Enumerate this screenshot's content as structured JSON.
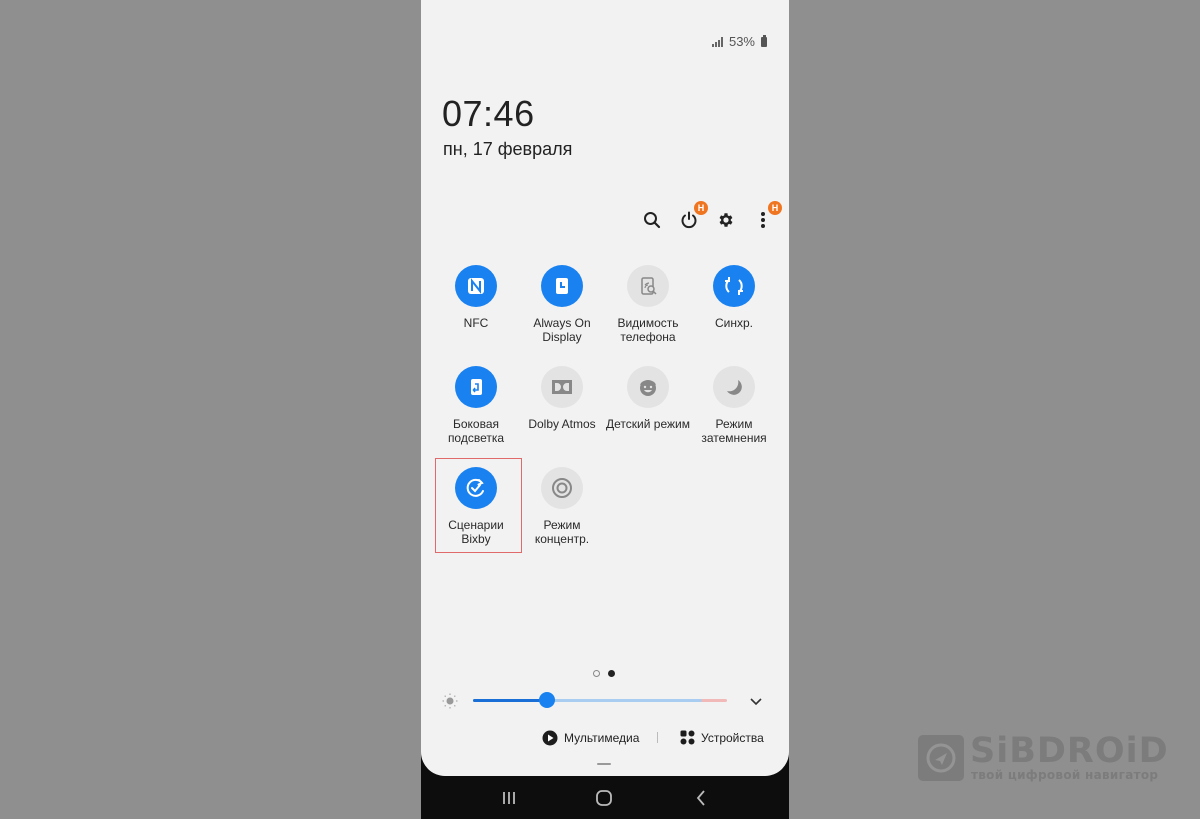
{
  "status_bar": {
    "battery_percent": "53%",
    "icons": [
      "signal-icon",
      "battery-icon"
    ]
  },
  "lockscreen": {
    "time": "07:46",
    "date": "пн, 17 февраля"
  },
  "toolbar": {
    "icons": [
      "search-icon",
      "power-icon",
      "settings-icon",
      "more-icon"
    ],
    "power_badge": "H",
    "more_badge": "H"
  },
  "quick_tiles": [
    {
      "label": "NFC",
      "icon": "nfc-icon",
      "active": true
    },
    {
      "label": "Always On Display",
      "icon": "always-on-display-icon",
      "active": true
    },
    {
      "label": "Видимость телефона",
      "icon": "phone-visibility-icon",
      "active": false
    },
    {
      "label": "Синхр.",
      "icon": "sync-icon",
      "active": true
    },
    {
      "label": "Боковая подсветка",
      "icon": "edge-lighting-icon",
      "active": true
    },
    {
      "label": "Dolby Atmos",
      "icon": "dolby-icon",
      "active": false
    },
    {
      "label": "Детский режим",
      "icon": "kids-mode-icon",
      "active": false
    },
    {
      "label": "Режим затемнения",
      "icon": "dark-mode-icon",
      "active": false
    },
    {
      "label": "Сценарии Bixby",
      "icon": "bixby-routines-icon",
      "active": true,
      "highlighted": true
    },
    {
      "label": "Режим концентр.",
      "icon": "focus-mode-icon",
      "active": false
    }
  ],
  "page_indicator": {
    "pages": 2,
    "current": 2
  },
  "brightness": {
    "level_fraction": 0.29
  },
  "media_bar": {
    "media_label": "Мультимедиа",
    "devices_label": "Устройства"
  },
  "navbar": {
    "buttons": [
      "recents-icon",
      "home-icon",
      "back-icon"
    ]
  },
  "watermark": {
    "title": "SiBDROiD",
    "subtitle": "твой цифровой навигатор"
  },
  "colors": {
    "accent": "#1a82f0",
    "badge": "#f07521",
    "highlight_border": "#e0696a"
  }
}
